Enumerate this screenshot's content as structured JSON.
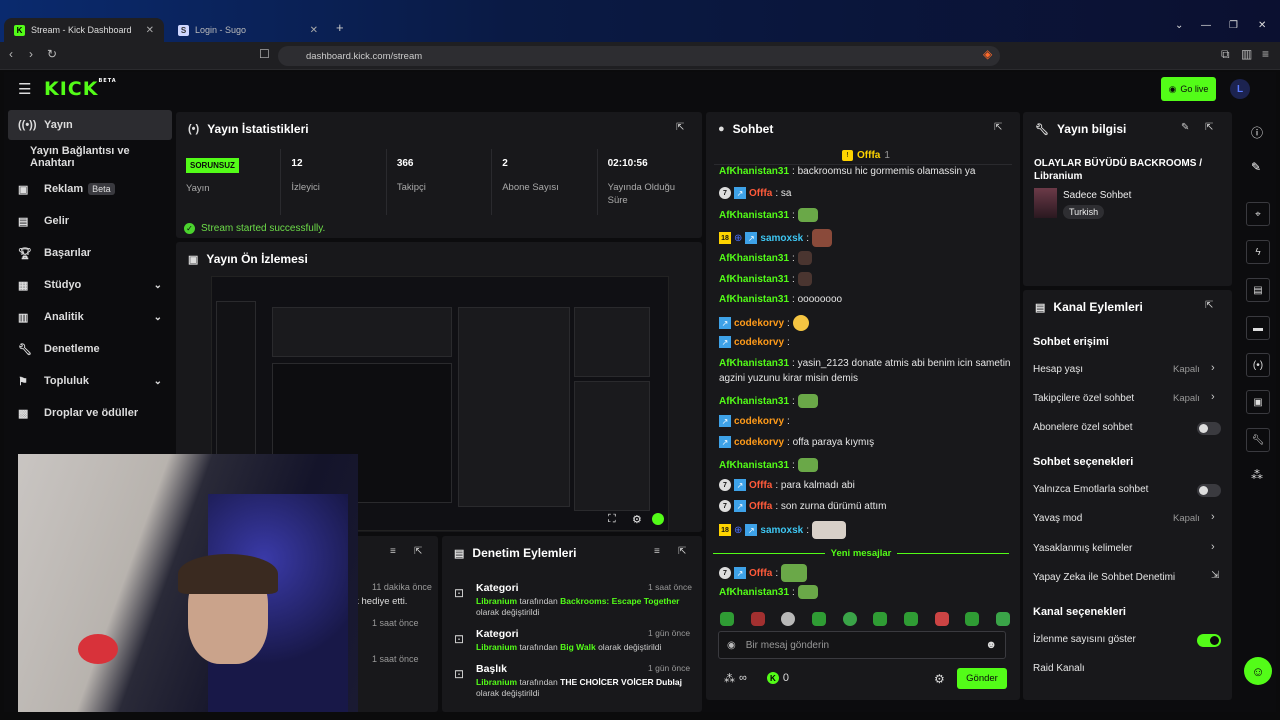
{
  "browser": {
    "tabs": [
      {
        "title": "Stream - Kick Dashboard"
      },
      {
        "title": "Login - Sugo"
      }
    ],
    "url": "dashboard.kick.com/stream"
  },
  "header": {
    "logo": "KICK",
    "logo_sup": "BETA",
    "go_live": "Go live",
    "avatar_letter": "L"
  },
  "sidebar": {
    "items": [
      {
        "label": "Yayın",
        "icon": "broadcast-icon"
      },
      {
        "label": "Yayın Bağlantısı ve Anahtarı",
        "icon": ""
      },
      {
        "label": "Reklam",
        "icon": "ad-icon",
        "badge": "Beta"
      },
      {
        "label": "Gelir",
        "icon": "revenue-icon"
      },
      {
        "label": "Başarılar",
        "icon": "trophy-icon"
      },
      {
        "label": "Stüdyo",
        "icon": "studio-icon"
      },
      {
        "label": "Analitik",
        "icon": "analytics-icon"
      },
      {
        "label": "Denetleme",
        "icon": "wrench-icon"
      },
      {
        "label": "Topluluk",
        "icon": "community-icon"
      },
      {
        "label": "Droplar ve ödüller",
        "icon": "drops-icon"
      }
    ]
  },
  "stats": {
    "title": "Yayın İstatistikleri",
    "status_badge": "SORUNSUZ",
    "status_label": "Yayın",
    "viewers": "12",
    "viewers_label": "İzleyici",
    "followers": "366",
    "followers_label": "Takipçi",
    "subs": "2",
    "subs_label": "Abone Sayısı",
    "uptime": "02:10:56",
    "uptime_label": "Yayında Olduğu Süre",
    "success": "Stream started successfully."
  },
  "preview": {
    "title": "Yayın Ön İzlemesi"
  },
  "lower_left": {
    "items": [
      {
        "time": "11 dakika önce",
        "text": "ik hediye etti."
      },
      {
        "time": "1 saat önce"
      },
      {
        "time": "1 saat önce"
      }
    ]
  },
  "moderation": {
    "title": "Denetim Eylemleri",
    "items": [
      {
        "type": "Kategori",
        "time": "1 saat önce",
        "user": "Libranium",
        "mid": "tarafından",
        "value": "Backrooms: Escape Together",
        "suffix": "olarak değiştirildi"
      },
      {
        "type": "Kategori",
        "time": "1 gün önce",
        "user": "Libranium",
        "mid": "tarafından",
        "value": "Big Walk",
        "suffix": "olarak değiştirildi"
      },
      {
        "type": "Başlık",
        "time": "1 gün önce",
        "user": "Libranium",
        "mid": "tarafından",
        "value": "THE CHOİCER VOİCER Dublaj",
        "suffix": "olarak değiştirildi"
      }
    ]
  },
  "chat": {
    "title": "Sohbet",
    "pinned_user": "Offfa",
    "pinned_count": "1",
    "messages": [
      {
        "user": "AfKhanistan31",
        "text": ": backroomsu hic gormemis olamassin ya"
      },
      {
        "user": "Offfa",
        "text": ": sa"
      },
      {
        "user": "AfKhanistan31",
        "text": ":"
      },
      {
        "user": "samoxsk",
        "text": ":"
      },
      {
        "user": "AfKhanistan31",
        "text": ":"
      },
      {
        "user": "AfKhanistan31",
        "text": ":"
      },
      {
        "user": "AfKhanistan31",
        "text": ": oooooooo"
      },
      {
        "user": "codekorvy",
        "text": ":"
      },
      {
        "user": "codekorvy",
        "text": ":"
      },
      {
        "user": "AfKhanistan31",
        "text": ": yasin_2123 donate atmis abi benim icin sametin"
      },
      {
        "user": "",
        "text": "agzini yuzunu kirar misin demis"
      },
      {
        "user": "AfKhanistan31",
        "text": ":"
      },
      {
        "user": "codekorvy",
        "text": ":"
      },
      {
        "user": "codekorvy",
        "text": ": offa paraya kıymış"
      },
      {
        "user": "AfKhanistan31",
        "text": ":"
      },
      {
        "user": "Offfa",
        "text": ": para kalmadı abi"
      },
      {
        "user": "Offfa",
        "text": ": son zurna dürümü attım"
      },
      {
        "user": "samoxsk",
        "text": ":"
      },
      {
        "user": "Offfa",
        "text": ":"
      },
      {
        "user": "AfKhanistan31",
        "text": ":"
      }
    ],
    "new_messages": "Yeni mesajlar",
    "badge_seven": "7",
    "badge_18": "18",
    "input_placeholder": "Bir mesaj gönderin",
    "send": "Gönder",
    "kick_count": "0",
    "infinity": "∞"
  },
  "info": {
    "title": "Yayın bilgisi",
    "stream_title": "OLAYLAR BÜYÜDÜ BACKROOMS / Libranium",
    "mode": "Sadece Sohbet",
    "language": "Turkish"
  },
  "channel_actions": {
    "title": "Kanal Eylemleri",
    "chat_access": "Sohbet erişimi",
    "account_age": "Hesap yaşı",
    "account_age_val": "Kapalı",
    "followers_only": "Takipçilere özel sohbet",
    "followers_only_val": "Kapalı",
    "subs_only": "Abonelere özel sohbet",
    "chat_options": "Sohbet seçenekleri",
    "emote_only": "Yalnızca Emotlarla sohbet",
    "slow_mode": "Yavaş mod",
    "slow_mode_val": "Kapalı",
    "banned_words": "Yasaklanmış kelimeler",
    "ai_mod": "Yapay Zeka ile Sohbet Denetimi",
    "channel_options": "Kanal seçenekleri",
    "show_viewers": "İzlenme sayısını göster",
    "raid": "Raid Kanalı"
  },
  "colors": {
    "accent": "#53fc18",
    "panel": "#18181b",
    "bg": "#0c0c0e"
  }
}
